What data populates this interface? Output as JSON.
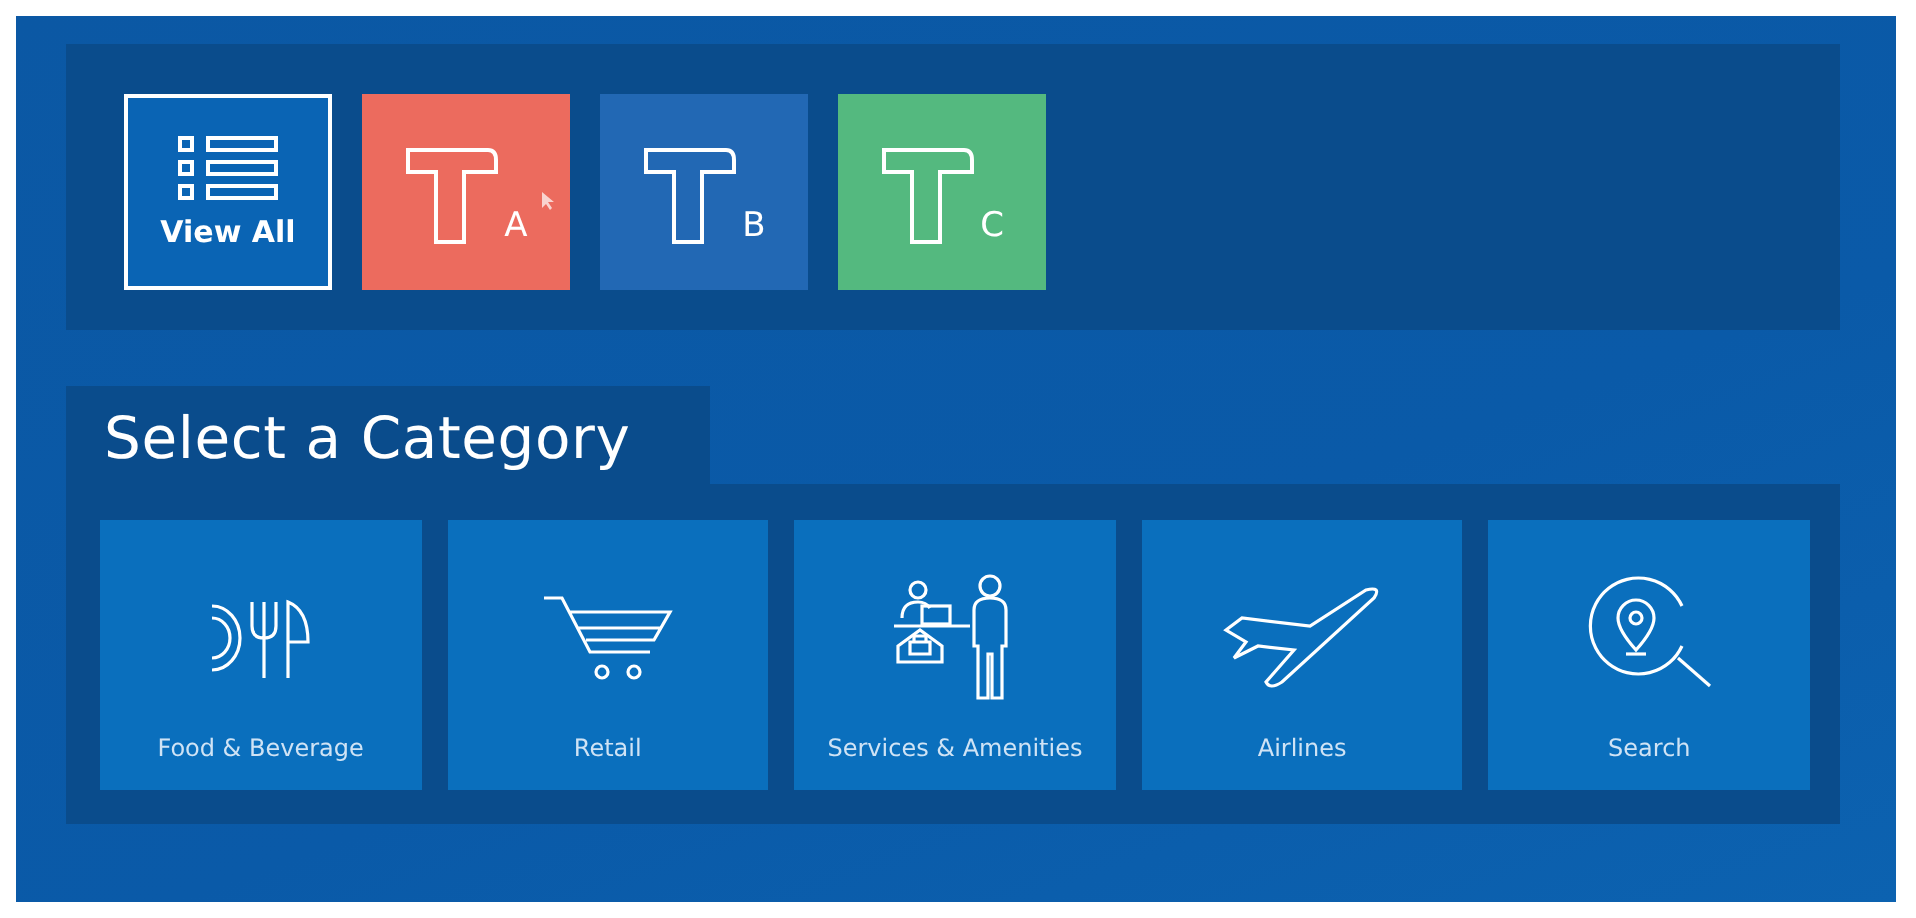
{
  "view_all": {
    "label": "View All",
    "selected": true
  },
  "terminals": [
    {
      "letter": "A",
      "color": "#ec6b5e",
      "hovered": true
    },
    {
      "letter": "B",
      "color": "#2268b4",
      "hovered": false
    },
    {
      "letter": "C",
      "color": "#54b97f",
      "hovered": false
    }
  ],
  "heading": "Select a Category",
  "categories": [
    {
      "label": "Food & Beverage",
      "kind": "food"
    },
    {
      "label": "Retail",
      "kind": "retail"
    },
    {
      "label": "Services & Amenities",
      "kind": "services"
    },
    {
      "label": "Airlines",
      "kind": "airlines"
    },
    {
      "label": "Search",
      "kind": "search"
    }
  ]
}
